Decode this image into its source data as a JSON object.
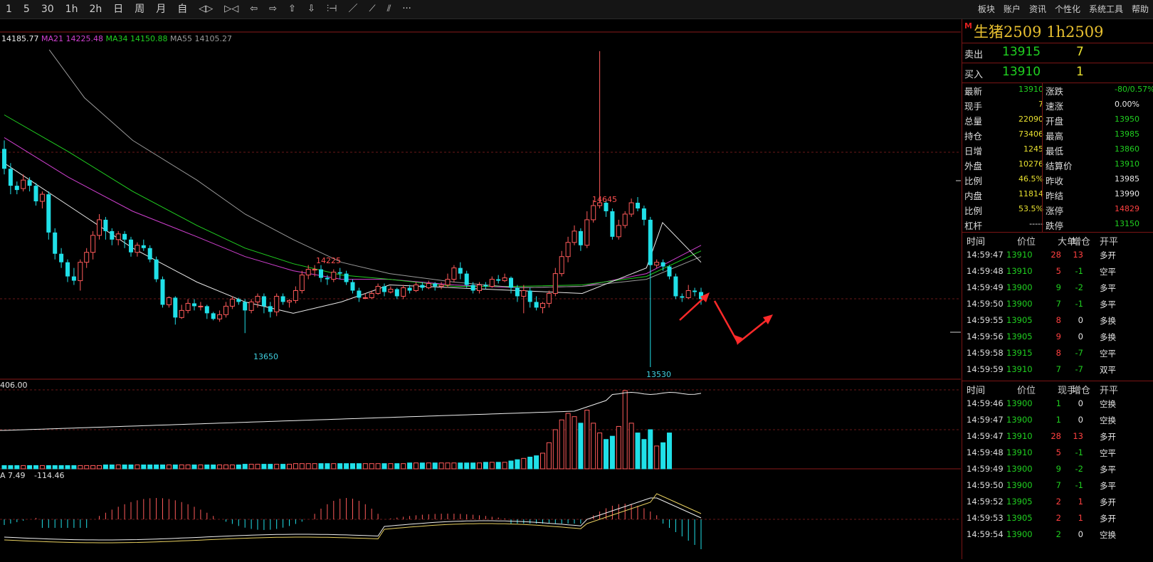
{
  "toolbar": {
    "periods": [
      "1",
      "5",
      "30",
      "1h",
      "2h",
      "日",
      "周",
      "月",
      "自"
    ],
    "tools": [
      "zoom-in-icon",
      "zoom-out-icon",
      "arrow-left-icon",
      "arrow-right-icon",
      "arrow-up-icon",
      "arrow-down-icon",
      "cursor-bar-icon",
      "line-tool-icon",
      "ray-tool-icon",
      "parallel-tool-icon",
      "more-icon"
    ],
    "tool_glyphs": [
      "◁▷",
      "▷◁",
      "⇦",
      "⇨",
      "⇧",
      "⇩",
      "⫶⊣",
      "／",
      "⟋",
      "⫽",
      "···"
    ],
    "menu": [
      "板块",
      "账户",
      "资讯",
      "个性化",
      "系统工具",
      "帮助"
    ]
  },
  "ma_legend": [
    {
      "label": "14185.77",
      "color": "#e8e8e8"
    },
    {
      "label": "MA21 14225.48",
      "color": "#d040d0"
    },
    {
      "label": "MA34 14150.88",
      "color": "#20d020"
    },
    {
      "label": "MA55 14105.27",
      "color": "#9a9a9a"
    }
  ],
  "price_annotations": {
    "high1": "14645",
    "high2": "14225",
    "low1": "13650",
    "low2": "13530"
  },
  "volume_label": "406.00",
  "macd_legend": {
    "a": "A 7.49",
    "b": "-114.46"
  },
  "chart_data": {
    "type": "candlestick",
    "price_range": [
      13500,
      14700
    ],
    "candles": [
      [
        14300,
        14230,
        14330,
        14210
      ],
      [
        14230,
        14170,
        14250,
        14140
      ],
      [
        14170,
        14155,
        14185,
        14140
      ],
      [
        14160,
        14190,
        14210,
        14150
      ],
      [
        14190,
        14170,
        14200,
        14150
      ],
      [
        14170,
        14115,
        14180,
        14100
      ],
      [
        14115,
        14140,
        14150,
        14090
      ],
      [
        14140,
        14005,
        14150,
        13980
      ],
      [
        14005,
        13930,
        14020,
        13910
      ],
      [
        13930,
        13900,
        13950,
        13880
      ],
      [
        13900,
        13850,
        13910,
        13830
      ],
      [
        13850,
        13835,
        13880,
        13820
      ],
      [
        13835,
        13900,
        13910,
        13800
      ],
      [
        13900,
        13935,
        13950,
        13880
      ],
      [
        13935,
        13995,
        14010,
        13910
      ],
      [
        13995,
        14050,
        14070,
        13980
      ],
      [
        14050,
        14010,
        14060,
        13980
      ],
      [
        14010,
        13980,
        14020,
        13960
      ],
      [
        13980,
        14000,
        14010,
        13960
      ],
      [
        14000,
        13980,
        14010,
        13950
      ],
      [
        13980,
        13935,
        13990,
        13920
      ],
      [
        13935,
        13960,
        13970,
        13920
      ],
      [
        13960,
        13950,
        13980,
        13940
      ],
      [
        13950,
        13910,
        13960,
        13900
      ],
      [
        13910,
        13840,
        13920,
        13830
      ],
      [
        13840,
        13750,
        13850,
        13740
      ],
      [
        13750,
        13775,
        13780,
        13740
      ],
      [
        13775,
        13705,
        13780,
        13680
      ],
      [
        13705,
        13730,
        13750,
        13700
      ],
      [
        13730,
        13755,
        13770,
        13720
      ],
      [
        13755,
        13745,
        13770,
        13730
      ],
      [
        13745,
        13745,
        13760,
        13730
      ],
      [
        13745,
        13720,
        13750,
        13700
      ],
      [
        13720,
        13700,
        13725,
        13695
      ],
      [
        13700,
        13715,
        13730,
        13690
      ],
      [
        13715,
        13745,
        13760,
        13705
      ],
      [
        13745,
        13770,
        13780,
        13735
      ],
      [
        13770,
        13760,
        13775,
        13750
      ],
      [
        13760,
        13730,
        13770,
        13650
      ],
      [
        13730,
        13760,
        13770,
        13720
      ],
      [
        13760,
        13780,
        13790,
        13740
      ],
      [
        13780,
        13745,
        13790,
        13720
      ],
      [
        13745,
        13725,
        13760,
        13705
      ],
      [
        13725,
        13780,
        13790,
        13710
      ],
      [
        13780,
        13760,
        13790,
        13750
      ],
      [
        13760,
        13765,
        13770,
        13740
      ],
      [
        13765,
        13800,
        13815,
        13755
      ],
      [
        13800,
        13855,
        13870,
        13790
      ],
      [
        13855,
        13875,
        13890,
        13840
      ],
      [
        13875,
        13875,
        13890,
        13850
      ],
      [
        13875,
        13845,
        13890,
        13830
      ],
      [
        13845,
        13840,
        13855,
        13820
      ],
      [
        13840,
        13865,
        13875,
        13830
      ],
      [
        13865,
        13860,
        13880,
        13840
      ],
      [
        13860,
        13830,
        13870,
        13820
      ],
      [
        13830,
        13800,
        13840,
        13790
      ],
      [
        13800,
        13775,
        13810,
        13760
      ],
      [
        13775,
        13775,
        13790,
        13770
      ],
      [
        13775,
        13790,
        13800,
        13770
      ],
      [
        13790,
        13815,
        13825,
        13785
      ],
      [
        13815,
        13795,
        13825,
        13780
      ],
      [
        13795,
        13805,
        13815,
        13790
      ],
      [
        13805,
        13780,
        13810,
        13770
      ],
      [
        13780,
        13810,
        13820,
        13770
      ],
      [
        13810,
        13800,
        13820,
        13790
      ],
      [
        13800,
        13820,
        13830,
        13795
      ],
      [
        13820,
        13810,
        13830,
        13800
      ],
      [
        13810,
        13825,
        13835,
        13805
      ],
      [
        13825,
        13815,
        13830,
        13800
      ],
      [
        13815,
        13820,
        13830,
        13805
      ],
      [
        13820,
        13840,
        13860,
        13810
      ],
      [
        13840,
        13880,
        13890,
        13830
      ],
      [
        13880,
        13860,
        13900,
        13840
      ],
      [
        13860,
        13820,
        13870,
        13810
      ],
      [
        13820,
        13800,
        13830,
        13790
      ],
      [
        13800,
        13820,
        13830,
        13790
      ],
      [
        13820,
        13815,
        13830,
        13805
      ],
      [
        13815,
        13840,
        13850,
        13810
      ],
      [
        13840,
        13835,
        13855,
        13825
      ],
      [
        13835,
        13845,
        13860,
        13830
      ],
      [
        13845,
        13810,
        13850,
        13790
      ],
      [
        13810,
        13780,
        13820,
        13760
      ],
      [
        13780,
        13800,
        13820,
        13720
      ],
      [
        13800,
        13760,
        13810,
        13740
      ],
      [
        13760,
        13740,
        13780,
        13730
      ],
      [
        13740,
        13755,
        13760,
        13720
      ],
      [
        13755,
        13790,
        13800,
        13740
      ],
      [
        13790,
        13860,
        13880,
        13780
      ],
      [
        13860,
        13920,
        13940,
        13850
      ],
      [
        13920,
        13970,
        13990,
        13900
      ],
      [
        13970,
        14010,
        14030,
        13960
      ],
      [
        14010,
        13960,
        14020,
        13940
      ],
      [
        13960,
        14050,
        14080,
        13950
      ],
      [
        14050,
        14100,
        14120,
        14040
      ],
      [
        14100,
        14110,
        14645,
        14090
      ],
      [
        14110,
        14080,
        14120,
        14060
      ],
      [
        14080,
        13990,
        14090,
        13980
      ],
      [
        13990,
        14030,
        14050,
        13980
      ],
      [
        14030,
        14070,
        14080,
        14020
      ],
      [
        14070,
        14110,
        14125,
        14060
      ],
      [
        14110,
        14090,
        14130,
        14080
      ],
      [
        14090,
        14050,
        14100,
        14030
      ],
      [
        14050,
        13890,
        14060,
        13530
      ],
      [
        13890,
        13900,
        13910,
        13880
      ],
      [
        13900,
        13885,
        13910,
        13870
      ],
      [
        13885,
        13850,
        13890,
        13840
      ],
      [
        13850,
        13780,
        13860,
        13770
      ],
      [
        13780,
        13775,
        13790,
        13760
      ],
      [
        13775,
        13800,
        13820,
        13770
      ],
      [
        13800,
        13795,
        13810,
        13780
      ],
      [
        13795,
        13770,
        13810,
        13750
      ]
    ],
    "ma_lines": [
      {
        "name": "MA21",
        "color": "#d040d0",
        "points": [
          [
            14340,
            0
          ],
          [
            14200,
            20
          ],
          [
            14080,
            40
          ],
          [
            13990,
            60
          ],
          [
            13920,
            75
          ],
          [
            13870,
            90
          ],
          [
            13840,
            105
          ],
          [
            13840,
            120
          ],
          [
            13820,
            140
          ],
          [
            13810,
            160
          ],
          [
            13815,
            180
          ],
          [
            13860,
            200
          ],
          [
            13960,
            217
          ]
        ]
      },
      {
        "name": "MA34",
        "color": "#20d020",
        "points": [
          [
            14420,
            0
          ],
          [
            14290,
            20
          ],
          [
            14150,
            40
          ],
          [
            14030,
            60
          ],
          [
            13950,
            75
          ],
          [
            13895,
            90
          ],
          [
            13855,
            105
          ],
          [
            13840,
            120
          ],
          [
            13815,
            140
          ],
          [
            13815,
            160
          ],
          [
            13820,
            180
          ],
          [
            13850,
            200
          ],
          [
            13940,
            217
          ]
        ]
      },
      {
        "name": "MA55",
        "color": "#9a9a9a",
        "points": [
          [
            14650,
            14
          ],
          [
            14480,
            25
          ],
          [
            14330,
            40
          ],
          [
            14190,
            60
          ],
          [
            14070,
            75
          ],
          [
            13980,
            90
          ],
          [
            13900,
            105
          ],
          [
            13860,
            120
          ],
          [
            13830,
            140
          ],
          [
            13810,
            160
          ],
          [
            13815,
            180
          ],
          [
            13840,
            200
          ],
          [
            13920,
            217
          ]
        ]
      },
      {
        "name": "MA5",
        "color": "#e8e8e8",
        "points": [
          [
            14250,
            0
          ],
          [
            14100,
            20
          ],
          [
            13950,
            40
          ],
          [
            13830,
            60
          ],
          [
            13760,
            75
          ],
          [
            13720,
            90
          ],
          [
            13760,
            105
          ],
          [
            13820,
            120
          ],
          [
            13810,
            140
          ],
          [
            13800,
            160
          ],
          [
            13790,
            180
          ],
          [
            13880,
            200
          ],
          [
            14040,
            205
          ],
          [
            13900,
            217
          ]
        ]
      }
    ],
    "volume": [
      5,
      5,
      5,
      5,
      5,
      5,
      5,
      5,
      5,
      5,
      5,
      5,
      5,
      5,
      5,
      5,
      6,
      6,
      6,
      6,
      6,
      6,
      6,
      6,
      6,
      6,
      6,
      6,
      6,
      6,
      6,
      6,
      6,
      6,
      6,
      6,
      6,
      6,
      7,
      7,
      7,
      7,
      7,
      7,
      7,
      7,
      8,
      8,
      8,
      8,
      8,
      8,
      8,
      8,
      8,
      8,
      8,
      8,
      8,
      8,
      8,
      8,
      8,
      8,
      9,
      9,
      9,
      9,
      9,
      9,
      9,
      9,
      9,
      9,
      9,
      9,
      10,
      10,
      10,
      10,
      12,
      14,
      16,
      18,
      20,
      24,
      40,
      60,
      75,
      85,
      80,
      70,
      90,
      70,
      55,
      45,
      50,
      65,
      120,
      70,
      55,
      45,
      60,
      35,
      40,
      55
    ],
    "volume_line_label": "406.00"
  },
  "panel": {
    "marker": "M",
    "name": "生猪2509  1h2509",
    "sell": {
      "label": "卖出",
      "price": "13915",
      "vol": "7"
    },
    "buy": {
      "label": "买入",
      "price": "13910",
      "vol": "1"
    },
    "quote": [
      {
        "l": "最新",
        "v": "13910",
        "c": "green",
        "l2": "涨跌",
        "v2": "-80/0.57%",
        "c2": "green"
      },
      {
        "l": "现手",
        "v": "7",
        "c": "yellow",
        "l2": "速涨",
        "v2": "0.00%",
        "c2": "white"
      },
      {
        "l": "总量",
        "v": "22090",
        "c": "yellow",
        "l2": "开盘",
        "v2": "13950",
        "c2": "green"
      },
      {
        "l": "持仓",
        "v": "73406",
        "c": "yellow",
        "l2": "最高",
        "v2": "13985",
        "c2": "green"
      },
      {
        "l": "日增",
        "v": "1245",
        "c": "yellow",
        "l2": "最低",
        "v2": "13860",
        "c2": "green"
      },
      {
        "l": "外盘",
        "v": "10276",
        "c": "yellow",
        "l2": "结算价",
        "v2": "13910",
        "c2": "green"
      },
      {
        "l": "比例",
        "v": "46.5%",
        "c": "yellow",
        "l2": "昨收",
        "v2": "13985",
        "c2": "white"
      },
      {
        "l": "内盘",
        "v": "11814",
        "c": "yellow",
        "l2": "昨结",
        "v2": "13990",
        "c2": "white"
      },
      {
        "l": "比例",
        "v": "53.5%",
        "c": "yellow",
        "l2": "涨停",
        "v2": "14829",
        "c2": "red"
      },
      {
        "l": "杠杆",
        "v": "-----",
        "c": "white",
        "l2": "跌停",
        "v2": "13150",
        "c2": "green"
      }
    ],
    "tick_head": [
      "时间",
      "价位",
      "大单",
      "增仓",
      "开平"
    ],
    "ticks1": [
      {
        "t": "14:59:47",
        "p": "13910",
        "v": "28",
        "oi": "13",
        "n": "多开",
        "pc": "green",
        "vc": "red",
        "oc": "red"
      },
      {
        "t": "14:59:48",
        "p": "13910",
        "v": "5",
        "oi": "-1",
        "n": "空平",
        "pc": "green",
        "vc": "red",
        "oc": "green"
      },
      {
        "t": "14:59:49",
        "p": "13900",
        "v": "9",
        "oi": "-2",
        "n": "多平",
        "pc": "green",
        "vc": "green",
        "oc": "green"
      },
      {
        "t": "14:59:50",
        "p": "13900",
        "v": "7",
        "oi": "-1",
        "n": "多平",
        "pc": "green",
        "vc": "green",
        "oc": "green"
      },
      {
        "t": "14:59:55",
        "p": "13905",
        "v": "8",
        "oi": "0",
        "n": "多换",
        "pc": "green",
        "vc": "red",
        "oc": "white"
      },
      {
        "t": "14:59:56",
        "p": "13905",
        "v": "9",
        "oi": "0",
        "n": "多换",
        "pc": "green",
        "vc": "red",
        "oc": "white"
      },
      {
        "t": "14:59:58",
        "p": "13915",
        "v": "8",
        "oi": "-7",
        "n": "空平",
        "pc": "green",
        "vc": "red",
        "oc": "green"
      },
      {
        "t": "14:59:59",
        "p": "13910",
        "v": "7",
        "oi": "-7",
        "n": "双平",
        "pc": "green",
        "vc": "green",
        "oc": "green"
      }
    ],
    "tick_head2": [
      "时间",
      "价位",
      "现手",
      "增仓",
      "开平"
    ],
    "ticks2": [
      {
        "t": "14:59:46",
        "p": "13900",
        "v": "1",
        "oi": "0",
        "n": "空换",
        "pc": "green",
        "vc": "green",
        "oc": "white"
      },
      {
        "t": "14:59:47",
        "p": "13900",
        "v": "1",
        "oi": "0",
        "n": "空换",
        "pc": "green",
        "vc": "green",
        "oc": "white"
      },
      {
        "t": "14:59:47",
        "p": "13910",
        "v": "28",
        "oi": "13",
        "n": "多开",
        "pc": "green",
        "vc": "red",
        "oc": "red"
      },
      {
        "t": "14:59:48",
        "p": "13910",
        "v": "5",
        "oi": "-1",
        "n": "空平",
        "pc": "green",
        "vc": "red",
        "oc": "green"
      },
      {
        "t": "14:59:49",
        "p": "13900",
        "v": "9",
        "oi": "-2",
        "n": "多平",
        "pc": "green",
        "vc": "green",
        "oc": "green"
      },
      {
        "t": "14:59:50",
        "p": "13900",
        "v": "7",
        "oi": "-1",
        "n": "多平",
        "pc": "green",
        "vc": "green",
        "oc": "green"
      },
      {
        "t": "14:59:52",
        "p": "13905",
        "v": "2",
        "oi": "1",
        "n": "多开",
        "pc": "green",
        "vc": "red",
        "oc": "red"
      },
      {
        "t": "14:59:53",
        "p": "13905",
        "v": "2",
        "oi": "1",
        "n": "多开",
        "pc": "green",
        "vc": "red",
        "oc": "red"
      },
      {
        "t": "14:59:54",
        "p": "13900",
        "v": "2",
        "oi": "0",
        "n": "空换",
        "pc": "green",
        "vc": "green",
        "oc": "white"
      }
    ]
  }
}
